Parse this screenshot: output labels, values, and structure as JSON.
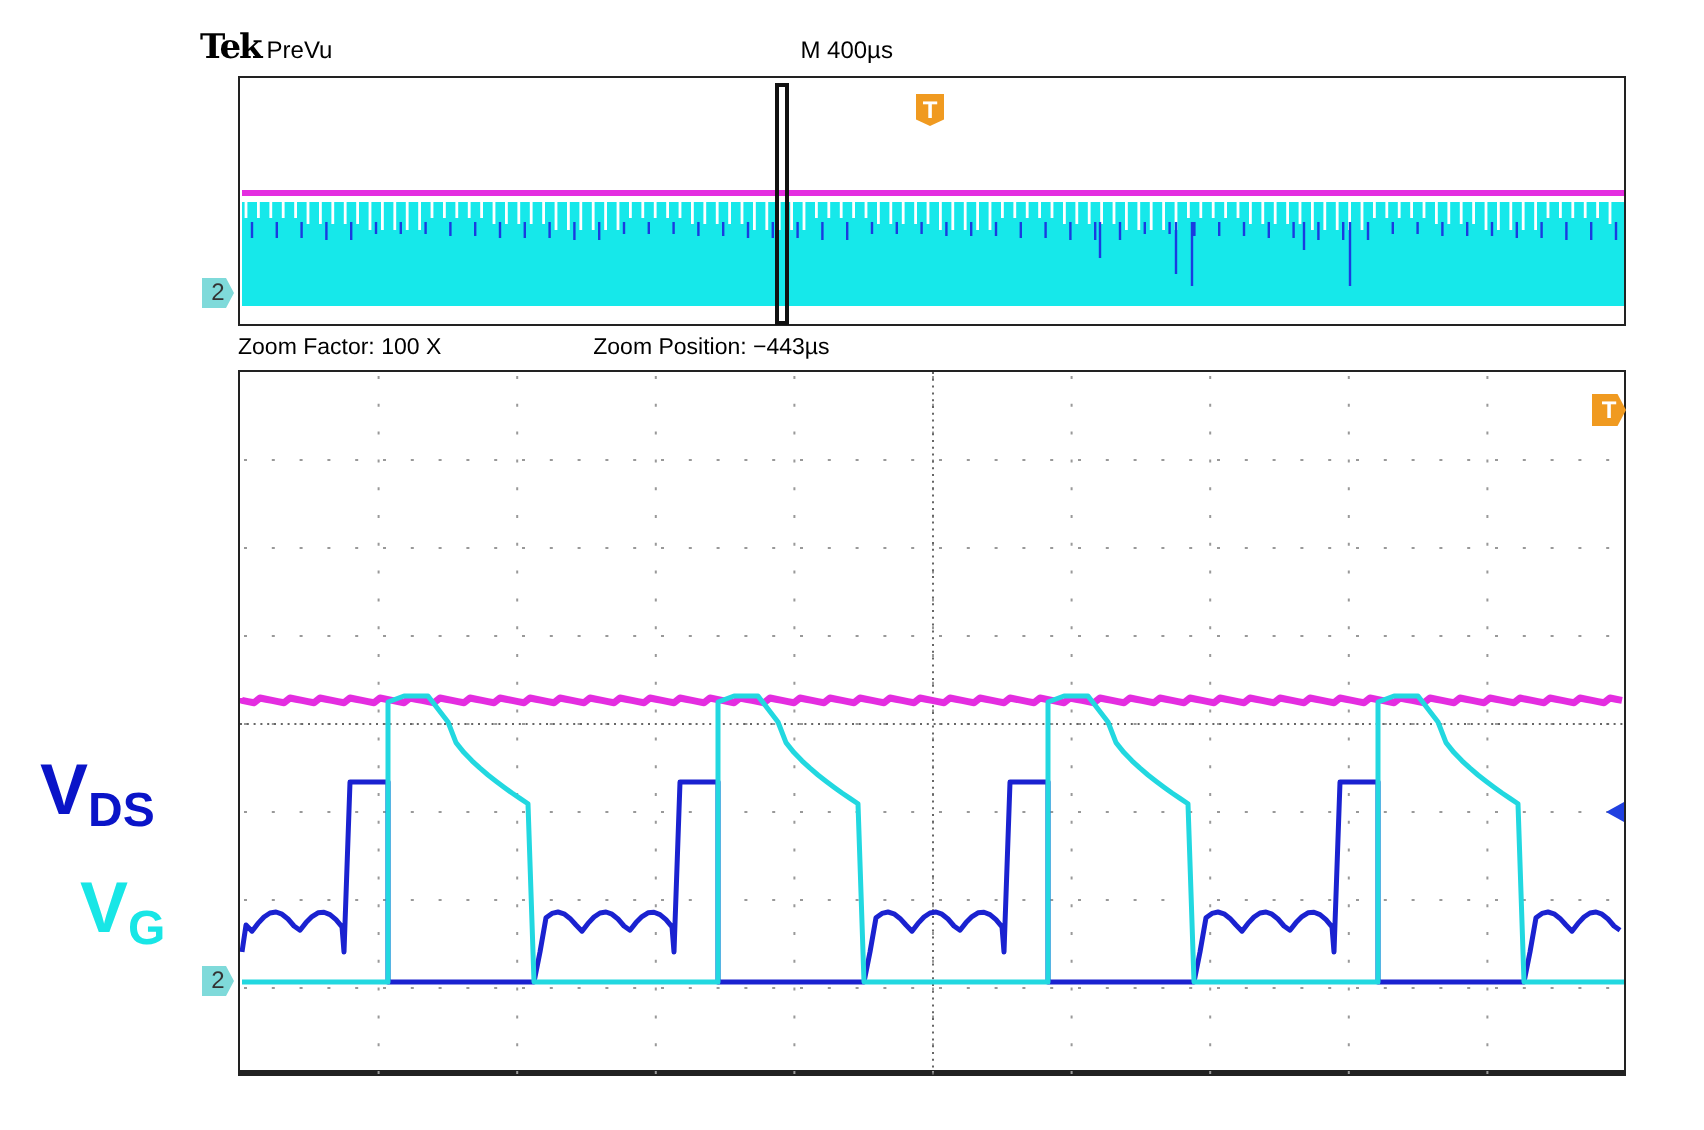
{
  "header": {
    "brand": "Tek",
    "mode": "PreVu",
    "timebase": "M 400µs"
  },
  "preview": {
    "channel_marker": "2",
    "trigger_marker": "T"
  },
  "zoom_info": {
    "factor": "Zoom Factor: 100 X",
    "position": "Zoom Position: −443µs"
  },
  "main": {
    "channel_marker": "2",
    "trigger_marker": "T"
  },
  "trace_labels": [
    {
      "text": "V$_{DS}$",
      "color": "#0a14c8"
    },
    {
      "text": "V$_{G}$",
      "color": "#18e6e6"
    }
  ]
}
